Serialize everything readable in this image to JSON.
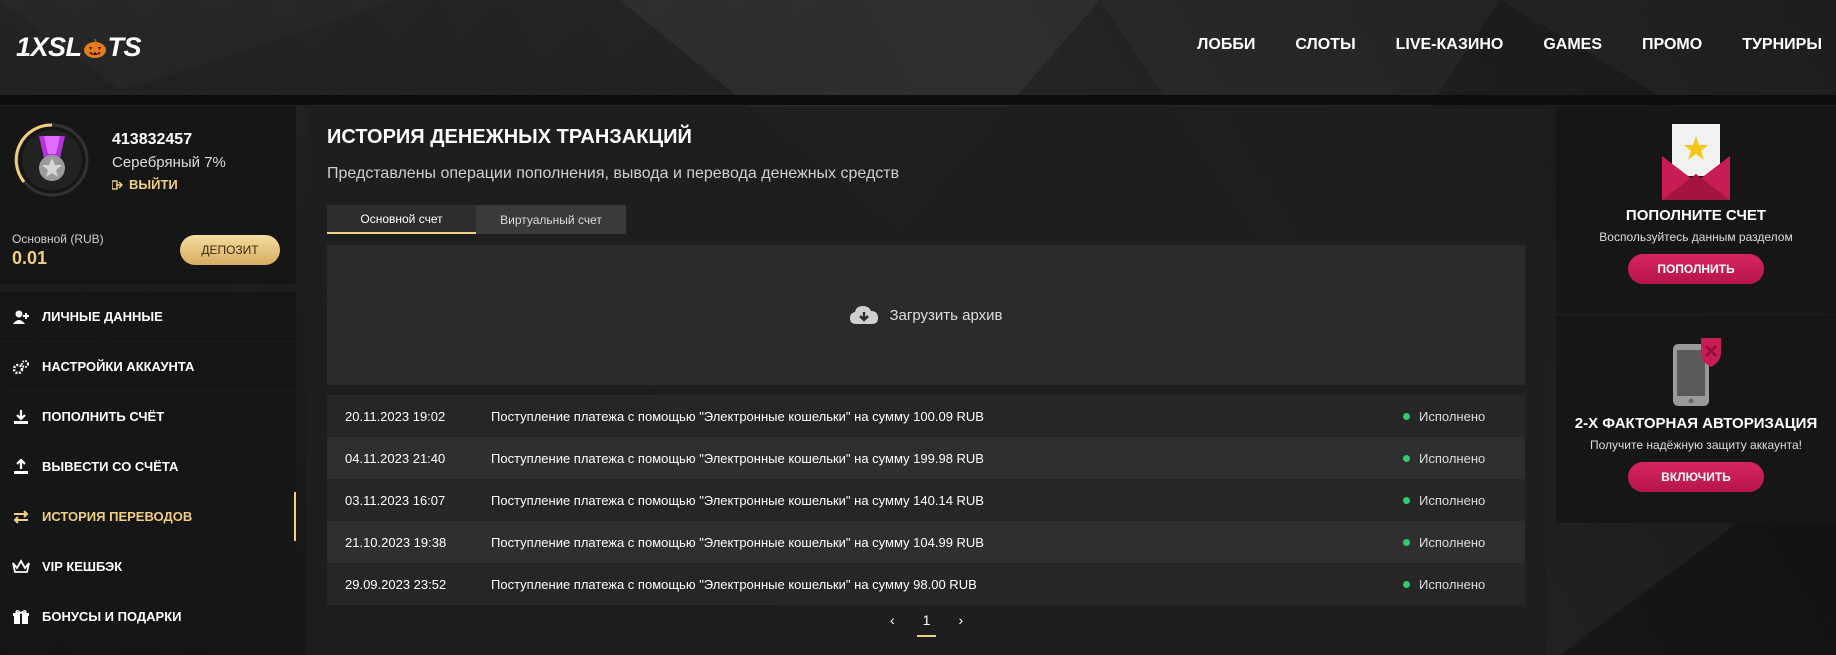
{
  "header": {
    "logo_text_before": "1X",
    "logo_text_after": "SL",
    "logo_text_end": "TS",
    "nav": [
      {
        "label": "ЛОББИ"
      },
      {
        "label": "СЛОТЫ"
      },
      {
        "label": "LIVE-КАЗИНО"
      },
      {
        "label": "GAMES"
      },
      {
        "label": "ПРОМО"
      },
      {
        "label": "ТУРНИРЫ"
      }
    ]
  },
  "profile": {
    "user_id": "413832457",
    "tier": "Серебряный 7%",
    "logout_label": "ВЫЙТИ",
    "balance_label": "Основной (RUB)",
    "balance_value": "0.01",
    "deposit_label": "ДЕПОЗИТ"
  },
  "sidebar": {
    "items": [
      {
        "label": "ЛИЧНЫЕ ДАННЫЕ",
        "icon": "user-plus-icon"
      },
      {
        "label": "НАСТРОЙКИ АККАУНТА",
        "icon": "gears-icon"
      },
      {
        "label": "ПОПОЛНИТЬ СЧЁТ",
        "icon": "download-icon"
      },
      {
        "label": "ВЫВЕСТИ СО СЧЁТА",
        "icon": "upload-icon"
      },
      {
        "label": "ИСТОРИЯ ПЕРЕВОДОВ",
        "icon": "transfer-icon",
        "active": true
      },
      {
        "label": "VIP КЕШБЭК",
        "icon": "crown-icon"
      },
      {
        "label": "БОНУСЫ И ПОДАРКИ",
        "icon": "gift-icon"
      }
    ]
  },
  "main": {
    "title": "ИСТОРИЯ ДЕНЕЖНЫХ ТРАНЗАКЦИЙ",
    "subtitle": "Представлены операции пополнения, вывода и перевода денежных средств",
    "tabs": [
      {
        "label": "Основной счет",
        "active": true
      },
      {
        "label": "Виртуальный счет",
        "active": false
      }
    ],
    "archive_label": "Загрузить архив",
    "transactions": [
      {
        "date": "20.11.2023 19:02",
        "description": "Поступление платежа с помощью \"Электронные кошельки\" на сумму 100.09 RUB",
        "status": "Исполнено"
      },
      {
        "date": "04.11.2023 21:40",
        "description": "Поступление платежа с помощью \"Электронные кошельки\" на сумму 199.98 RUB",
        "status": "Исполнено"
      },
      {
        "date": "03.11.2023 16:07",
        "description": "Поступление платежа с помощью \"Электронные кошельки\" на сумму 140.14 RUB",
        "status": "Исполнено"
      },
      {
        "date": "21.10.2023 19:38",
        "description": "Поступление платежа с помощью \"Электронные кошельки\" на сумму 104.99 RUB",
        "status": "Исполнено"
      },
      {
        "date": "29.09.2023 23:52",
        "description": "Поступление платежа с помощью \"Электронные кошельки\" на сумму 98.00 RUB",
        "status": "Исполнено"
      }
    ],
    "pagination": {
      "prev": "‹",
      "current": "1",
      "next": "›"
    }
  },
  "widgets": {
    "deposit": {
      "title": "ПОПОЛНИТЕ СЧЕТ",
      "text": "Воспользуйтесь данным разделом",
      "button": "ПОПОЛНИТЬ"
    },
    "twofa": {
      "title": "2-Х ФАКТОРНАЯ АВТОРИЗАЦИЯ",
      "text": "Получите надёжную защиту аккаунта!",
      "button": "ВКЛЮЧИТЬ"
    }
  },
  "colors": {
    "accent_gold": "#f1cf80",
    "accent_pink": "#c81d54",
    "status_green": "#2ecc71"
  }
}
